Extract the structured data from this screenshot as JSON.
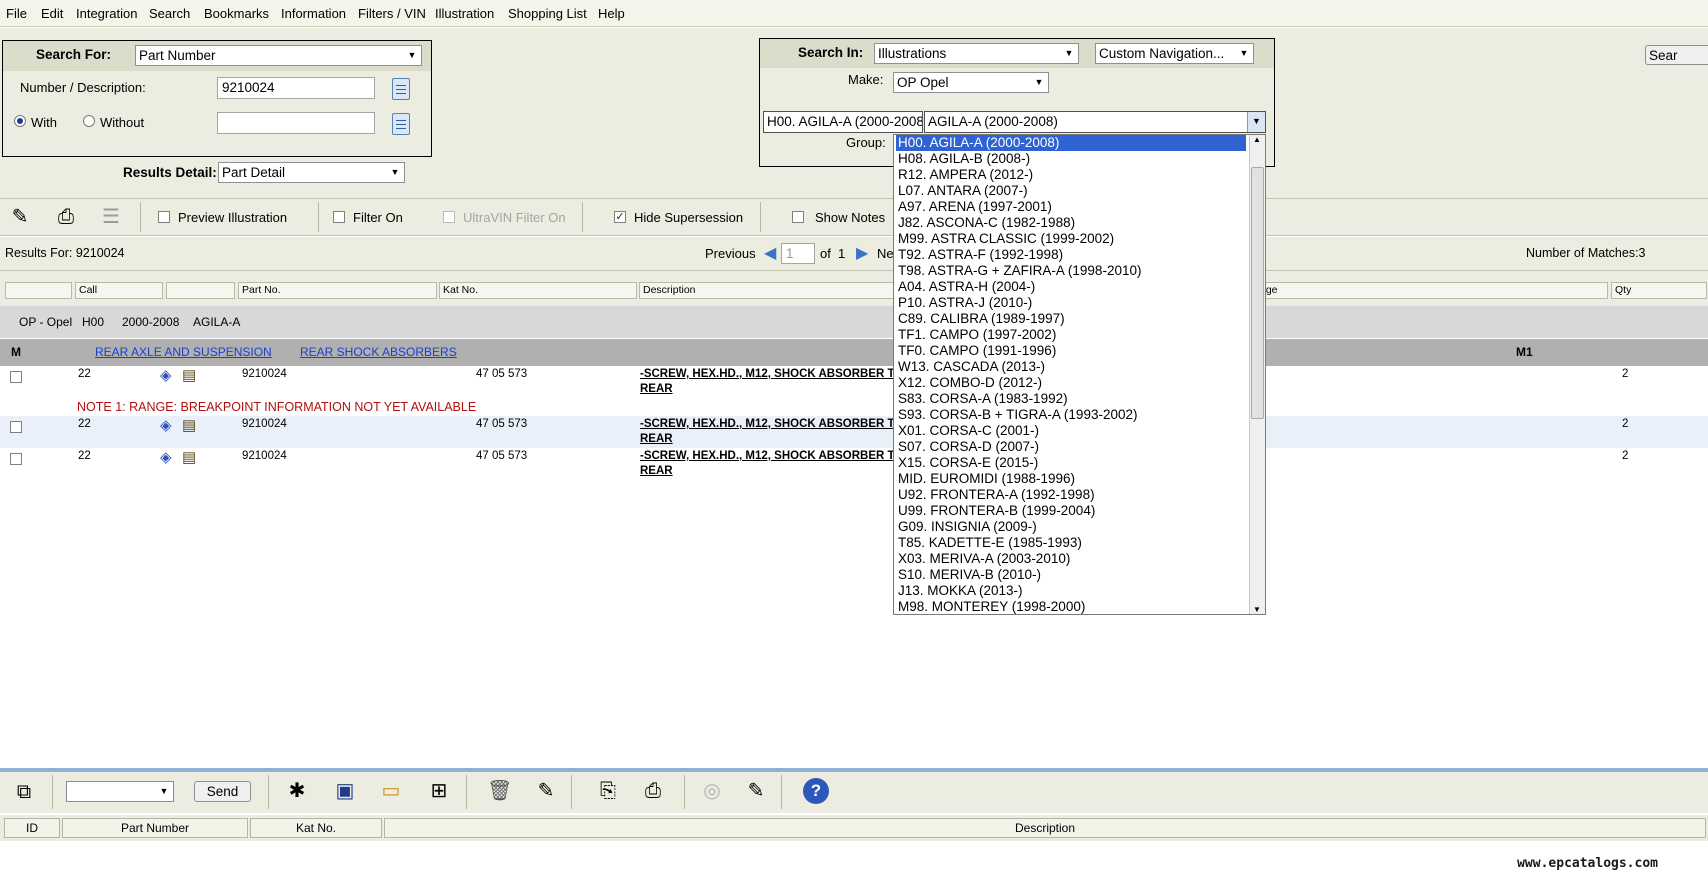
{
  "menu": [
    "File",
    "Edit",
    "Integration",
    "Search",
    "Bookmarks",
    "Information",
    "Filters / VIN",
    "Illustration",
    "Shopping List",
    "Help"
  ],
  "search_for": {
    "label": "Search For:",
    "value": "Part Number",
    "number_label": "Number / Description:",
    "number_value": "9210024",
    "with_label": "With",
    "without_label": "Without",
    "results_detail_label": "Results Detail:",
    "results_detail_value": "Part Detail"
  },
  "search_in": {
    "label": "Search In:",
    "value": "Illustrations",
    "nav_value": "Custom Navigation...",
    "make_label": "Make:",
    "make_value": "OP   Opel",
    "model_code": "H00. AGILA-A (2000-2008)",
    "model_value": "AGILA-A (2000-2008)",
    "group_label": "Group:",
    "search_button": "Sear"
  },
  "toolbar": {
    "preview_label": "Preview Illustration",
    "filter_label": "Filter On",
    "ultravin_label": "UltraVIN Filter On",
    "hide_super_label": "Hide Supersession",
    "show_notes_label": "Show Notes"
  },
  "results": {
    "results_for": "Results For: 9210024",
    "previous": "Previous",
    "page": "1",
    "of": "of",
    "total_pages": "1",
    "next": "Ne",
    "matches": "Number of Matches:3"
  },
  "columns": {
    "call": "Call",
    "part_no": "Part No.",
    "kat_no": "Kat No.",
    "description": "Description",
    "range": "nge",
    "qty": "Qty"
  },
  "group_row": {
    "make": "OP - Opel",
    "code": "H00",
    "years": "2000-2008",
    "model": "AGILA-A"
  },
  "section": {
    "m": "M",
    "link1": "REAR AXLE AND SUSPENSION",
    "link2": "REAR SHOCK ABSORBERS",
    "m1": "M1"
  },
  "rows": [
    {
      "call": "22",
      "part": "9210024",
      "kat": "47 05 573",
      "desc1": "-SCREW, HEX.HD., M12, SHOCK ABSORBER T",
      "desc2": "REAR",
      "qty": "2"
    },
    {
      "call": "22",
      "part": "9210024",
      "kat": "47 05 573",
      "desc1": "-SCREW, HEX.HD., M12, SHOCK ABSORBER T",
      "desc2": "REAR",
      "qty": "2"
    },
    {
      "call": "22",
      "part": "9210024",
      "kat": "47 05 573",
      "desc1": "-SCREW, HEX.HD., M12, SHOCK ABSORBER T",
      "desc2": "REAR",
      "qty": "2"
    }
  ],
  "note": "NOTE 1: RANGE: BREAKPOINT INFORMATION NOT YET AVAILABLE",
  "model_options": [
    "H00. AGILA-A (2000-2008)",
    "H08. AGILA-B (2008-)",
    "R12. AMPERA (2012-)",
    "L07. ANTARA (2007-)",
    "A97. ARENA (1997-2001)",
    "J82. ASCONA-C (1982-1988)",
    "M99. ASTRA CLASSIC (1999-2002)",
    "T92. ASTRA-F (1992-1998)",
    "T98. ASTRA-G + ZAFIRA-A (1998-2010)",
    "A04. ASTRA-H (2004-)",
    "P10. ASTRA-J (2010-)",
    "C89. CALIBRA (1989-1997)",
    "TF1. CAMPO (1997-2002)",
    "TF0. CAMPO (1991-1996)",
    "W13. CASCADA (2013-)",
    "X12. COMBO-D (2012-)",
    "S83. CORSA-A (1983-1992)",
    "S93. CORSA-B + TIGRA-A (1993-2002)",
    "X01. CORSA-C (2001-)",
    "S07. CORSA-D (2007-)",
    "X15. CORSA-E (2015-)",
    "MID. EUROMIDI (1988-1996)",
    "U92. FRONTERA-A (1992-1998)",
    "U99. FRONTERA-B (1999-2004)",
    "G09. INSIGNIA (2009-)",
    "T85. KADETTE-E (1985-1993)",
    "X03. MERIVA-A (2003-2010)",
    "S10. MERIVA-B (2010-)",
    "J13. MOKKA (2013-)",
    "M98. MONTEREY (1998-2000)"
  ],
  "bottom": {
    "send": "Send",
    "id": "ID",
    "part_number": "Part Number",
    "kat_no": "Kat No.",
    "description": "Description"
  },
  "watermark": "www.epcatalogs.com",
  "colors": {
    "accent": "#2f62d2",
    "link": "#1a3fd1",
    "note": "#b01010",
    "panel": "#ecece0"
  }
}
